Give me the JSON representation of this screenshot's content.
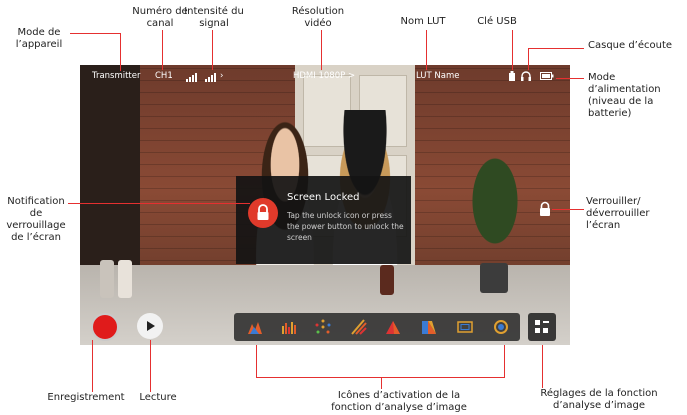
{
  "callouts": {
    "device_mode": "Mode de l’appareil",
    "channel_number": "Numéro de canal",
    "signal_strength": "Intensité du signal",
    "video_resolution": "Résolution vidéo",
    "lut_name": "Nom LUT",
    "usb_key": "Clé USB",
    "headphones": "Casque d’écoute",
    "power_mode": "Mode d’alimentation (niveau de la batterie)",
    "lock_notification": "Notification de verrouillage de l’écran",
    "lock_unlock": "Verrouiller/ déverrouiller l’écran",
    "record": "Enregistrement",
    "playback": "Lecture",
    "analysis_icons": "Icônes d’activation de la fonction d’analyse d’image",
    "analysis_settings": "Réglages de la fonction d’analyse d’image"
  },
  "screen": {
    "mode": "Transmitter",
    "channel": "CH1",
    "resolution": "HDMI 1080P >",
    "lut": "LUT Name",
    "lock_title": "Screen Locked",
    "lock_message": "Tap the unlock icon or press the power button to unlock the screen"
  },
  "colors": {
    "accent": "#e53030",
    "lock_badge": "#e03a2b",
    "record": "#e01b1b"
  },
  "icons": [
    "histogram-icon",
    "waveform-icon",
    "vectorscope-icon",
    "zebra-icon",
    "false-color-icon",
    "focus-peaking-icon",
    "frame-guide-icon",
    "anamorphic-icon"
  ]
}
